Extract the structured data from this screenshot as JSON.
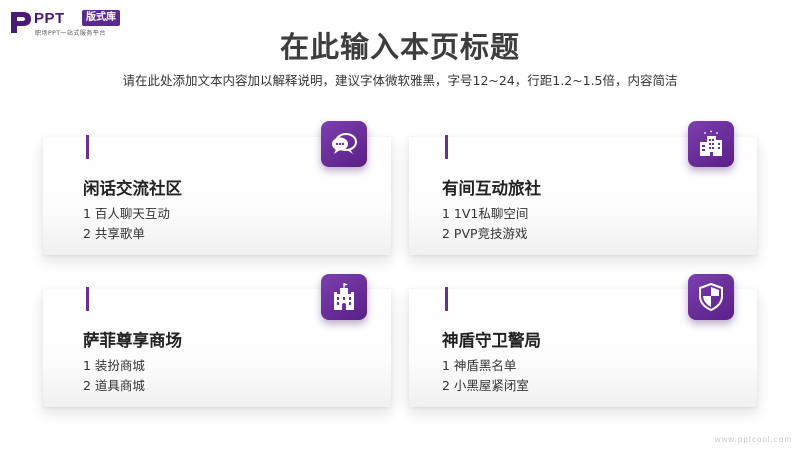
{
  "logo": {
    "ppt": "PPT",
    "badge": "版式库",
    "subtitle": "职场PPT一站式服务平台"
  },
  "title": "在此输入本页标题",
  "subtitle": "请在此处添加文本内容加以解释说明，建议字体微软雅黑，字号12~24，行距1.2~1.5倍，内容简洁",
  "cards": [
    {
      "title": "闲话交流社区",
      "items": [
        "1 百人聊天互动",
        "2 共享歌单"
      ],
      "icon": "chat-bubbles-icon"
    },
    {
      "title": "有间互动旅社",
      "items": [
        "1 1V1私聊空间",
        "2 PVP竞技游戏"
      ],
      "icon": "buildings-icon"
    },
    {
      "title": "萨菲尊享商场",
      "items": [
        "1 装扮商城",
        "2 道具商城"
      ],
      "icon": "castle-icon"
    },
    {
      "title": "神盾守卫警局",
      "items": [
        "1 神盾黑名单",
        "2 小黑屋紧闭室"
      ],
      "icon": "shield-icon"
    }
  ],
  "watermark": "www.pptcool.com",
  "colors": {
    "accent": "#6b2d96",
    "icon_bg": "#6a2fa0",
    "title": "#3d3d3d"
  }
}
